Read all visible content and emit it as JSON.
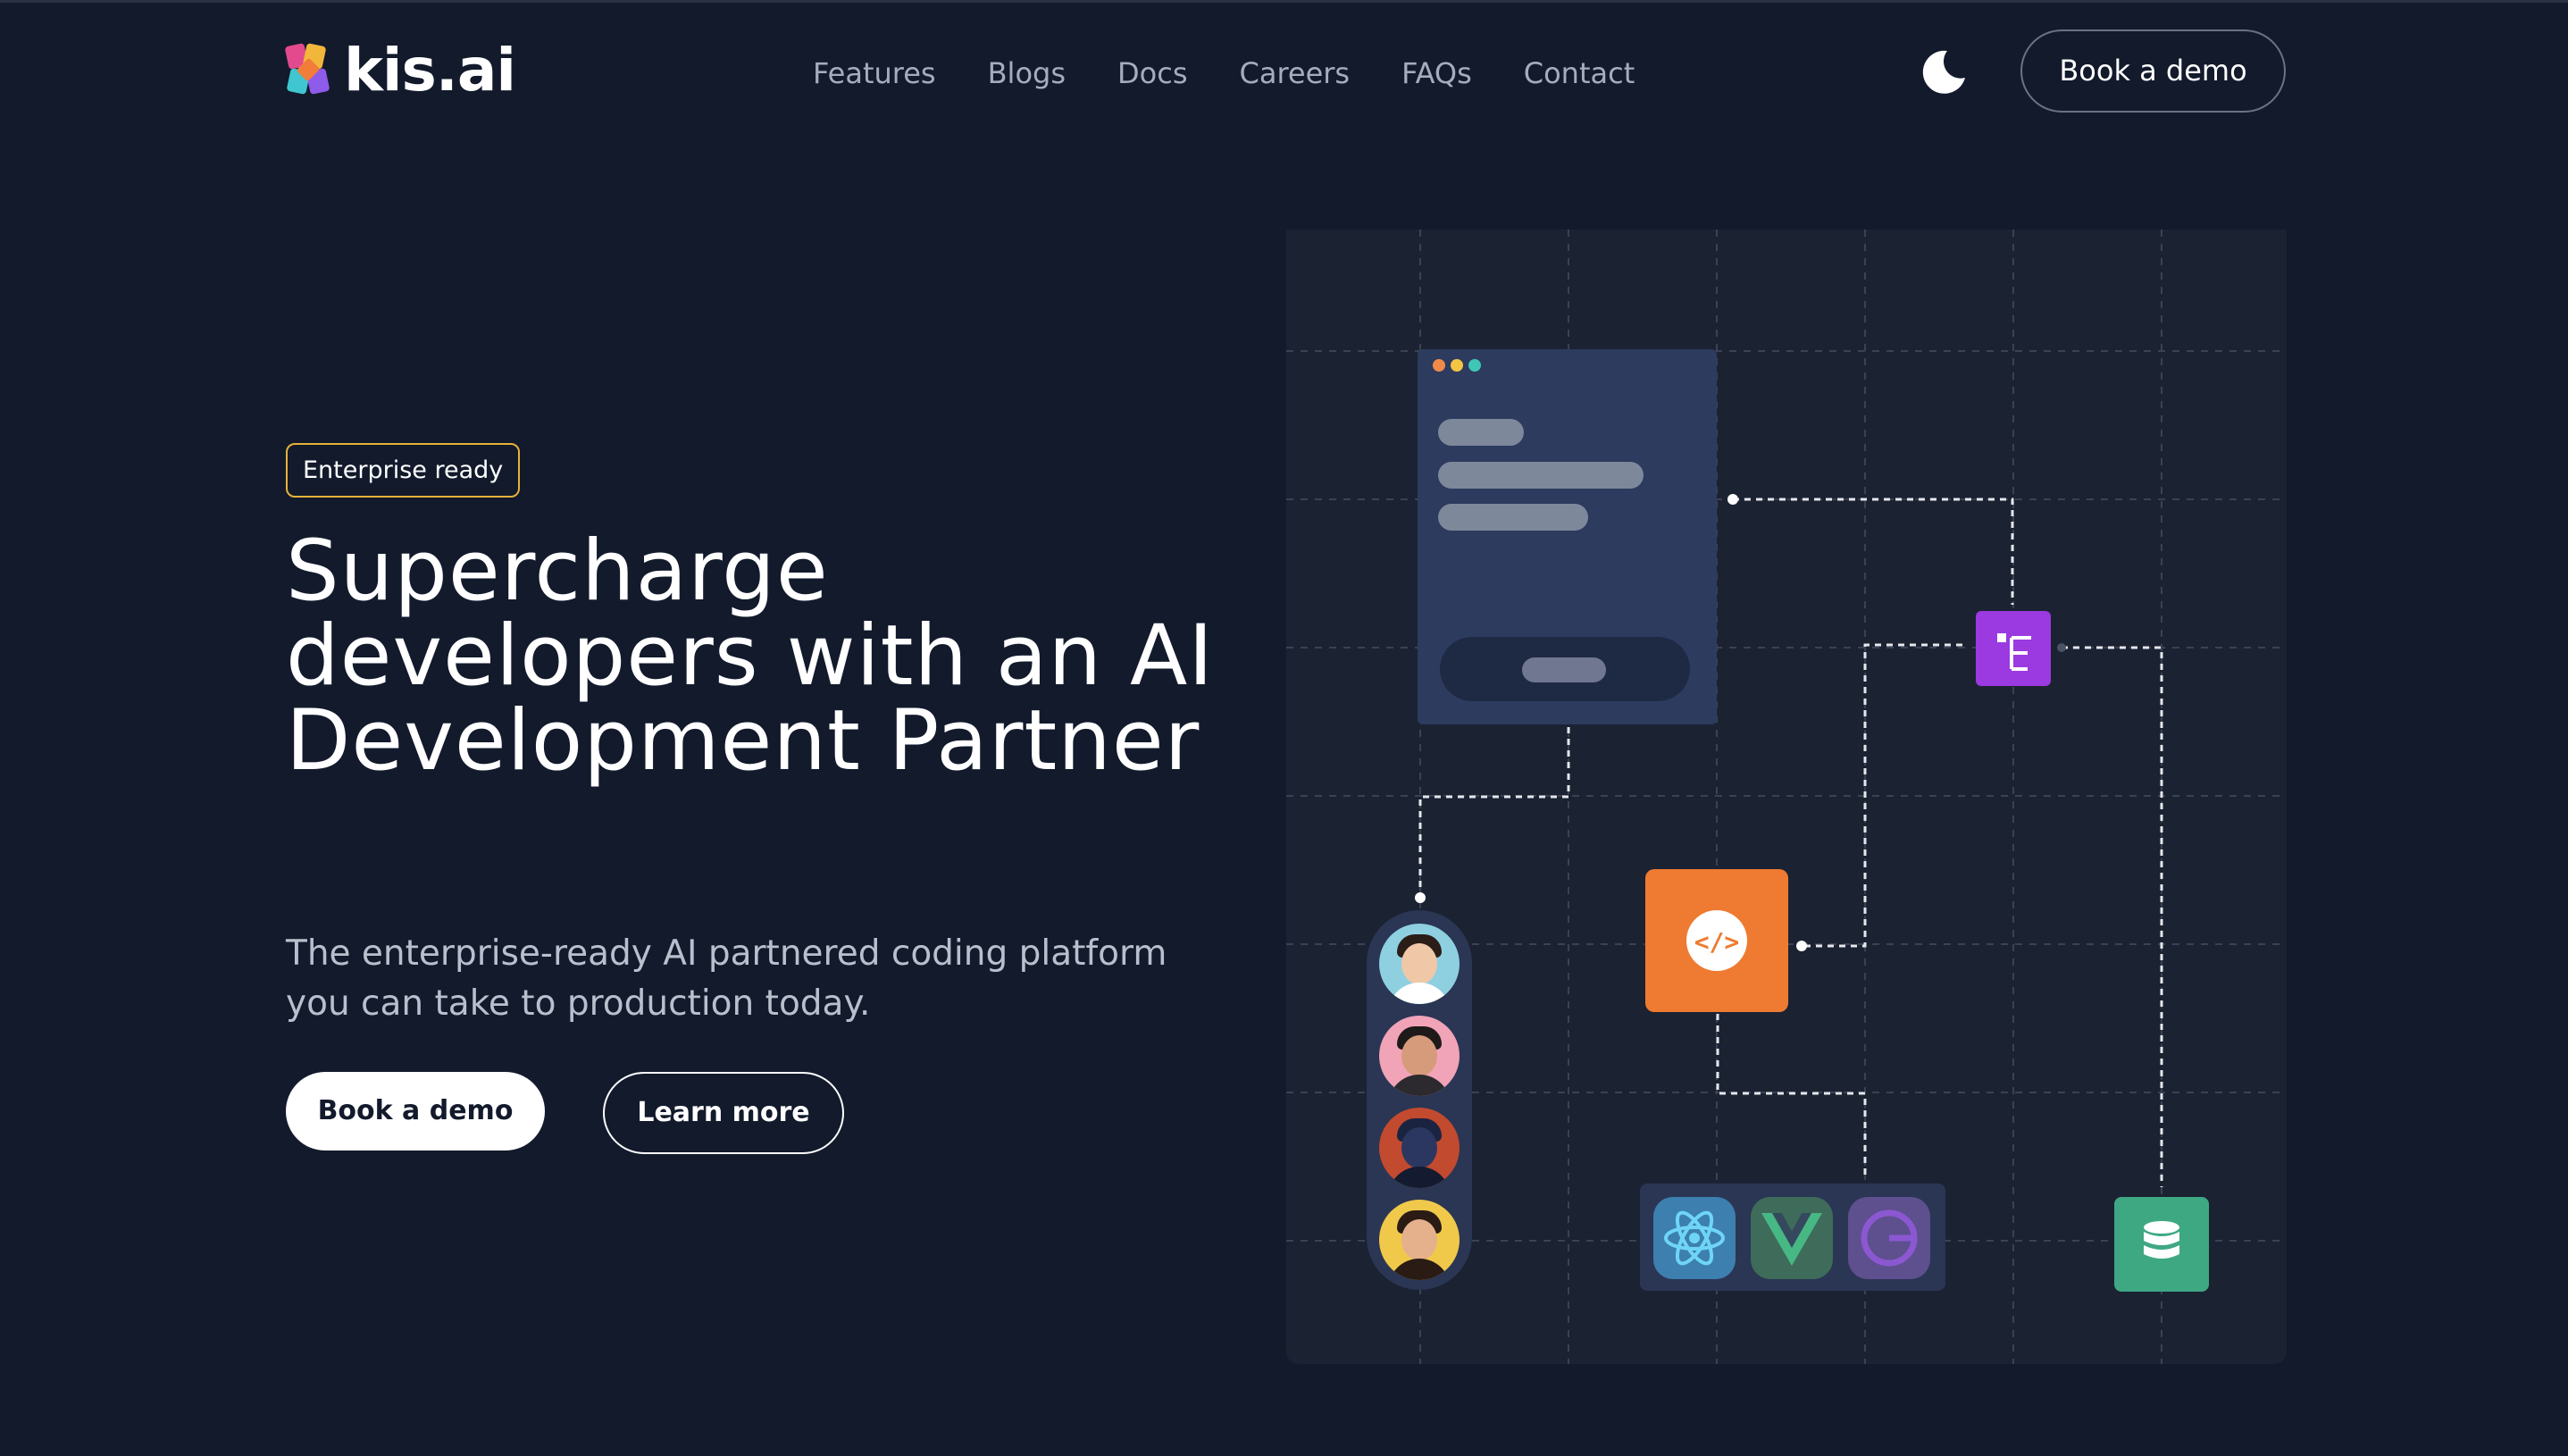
{
  "brand": {
    "name": "kis.ai"
  },
  "nav": {
    "items": [
      "Features",
      "Blogs",
      "Docs",
      "Careers",
      "FAQs",
      "Contact"
    ]
  },
  "header": {
    "theme_icon": "moon-icon",
    "cta_label": "Book a demo"
  },
  "hero": {
    "badge": "Enterprise ready",
    "headline": "Supercharge developers with an AI Development Partner",
    "subtitle": "The enterprise-ready AI partnered coding platform you can take to production today.",
    "primary_cta": "Book a demo",
    "secondary_cta": "Learn more"
  },
  "illustration": {
    "nodes": [
      "window-card",
      "avatar-stack",
      "code-node",
      "tree-node",
      "framework-tray",
      "database-node"
    ],
    "framework_icons": [
      "react-icon",
      "vue-icon",
      "gatsby-icon"
    ],
    "colors": {
      "background": "#121a2c",
      "panel": "#1b2232",
      "code_node": "#ee7b31",
      "tree_node": "#9b3ae0",
      "db_node": "#3ea883",
      "badge_border": "#e6b23a"
    }
  }
}
